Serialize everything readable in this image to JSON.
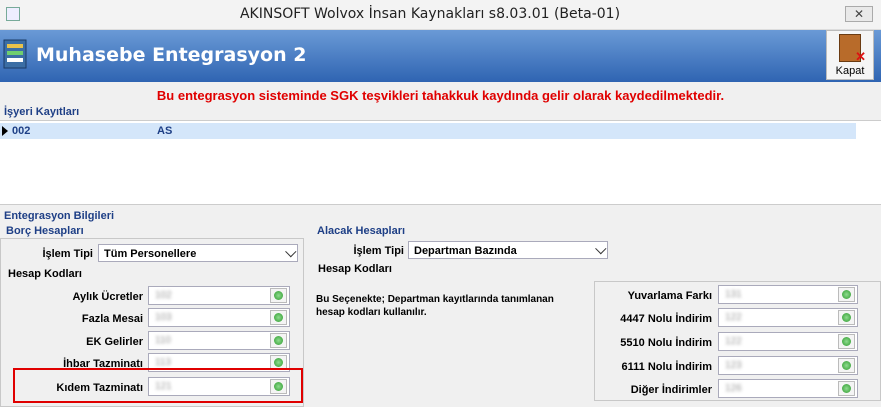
{
  "window": {
    "title": "AKINSOFT Wolvox İnsan Kaynakları s8.03.01 (Beta-01)",
    "close_glyph": "✕"
  },
  "header": {
    "title": "Muhasebe Entegrasyon 2",
    "kapat_label": "Kapat"
  },
  "warning": "Bu entegrasyon sisteminde SGK teşvikleri tahakkuk kaydında gelir olarak kaydedilmektedir.",
  "isyeri": {
    "label": "İşyeri Kayıtları",
    "rows": [
      {
        "code": "002",
        "name": "AS"
      }
    ]
  },
  "entegrasyon": {
    "label": "Entegrasyon Bilgileri"
  },
  "borc": {
    "label": "Borç Hesapları",
    "islem_tipi_label": "İşlem Tipi",
    "islem_tipi_value": "Tüm Personellere",
    "hesap_kodlari_label": "Hesap Kodları",
    "fields": [
      {
        "label": "Aylık Ücretler",
        "value": "102"
      },
      {
        "label": "Fazla Mesai",
        "value": "103"
      },
      {
        "label": "EK Gelirler",
        "value": "110"
      },
      {
        "label": "İhbar Tazminatı",
        "value": "113"
      },
      {
        "label": "Kıdem Tazminatı",
        "value": "121"
      }
    ]
  },
  "alacak": {
    "label": "Alacak Hesapları",
    "islem_tipi_label": "İşlem Tipi",
    "islem_tipi_value": "Departman Bazında",
    "hesap_kodlari_label": "Hesap Kodları",
    "info": "Bu Seçenekte; Departman kayıtlarında tanımlanan hesap kodları kullanılır.",
    "fields": [
      {
        "label": "Yuvarlama Farkı",
        "value": "131"
      },
      {
        "label": "4447 Nolu İndirim",
        "value": "122"
      },
      {
        "label": "5510 Nolu İndirim",
        "value": "122"
      },
      {
        "label": "6111 Nolu İndirim",
        "value": "123"
      },
      {
        "label": "Diğer İndirimler",
        "value": "126"
      }
    ]
  },
  "icons": [
    "app-icon",
    "integration-icon",
    "door-exit-icon",
    "green-lookup-icon",
    "chevron-down-icon",
    "row-pointer-icon"
  ]
}
